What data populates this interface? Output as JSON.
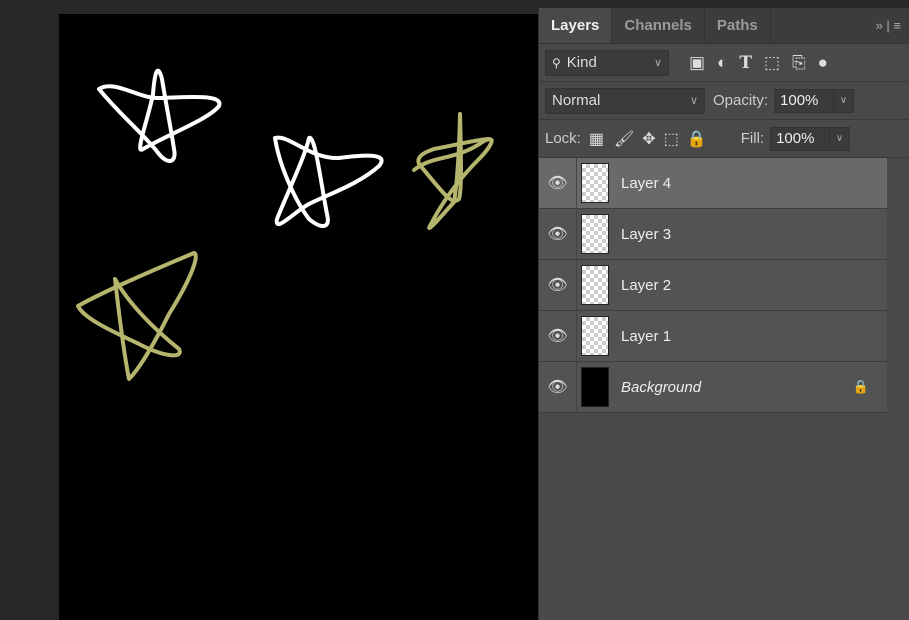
{
  "panel": {
    "tabs": [
      {
        "label": "Layers",
        "active": true
      },
      {
        "label": "Channels"
      },
      {
        "label": "Paths"
      }
    ],
    "menu_icons": "»  |  ≡",
    "filter": {
      "label": "Kind",
      "icon": "search-icon"
    },
    "filter_icons": [
      "image-filter-icon",
      "adjustment-filter-icon",
      "type-filter-icon",
      "shape-filter-icon",
      "smart-object-filter-icon",
      "filter-toggle-icon"
    ],
    "blend_mode": "Normal",
    "opacity_label": "Opacity:",
    "opacity": "100%",
    "lock_label": "Lock:",
    "fill_label": "Fill:",
    "fill": "100%",
    "layers": [
      {
        "name": "Layer 4",
        "selected": true,
        "visible": true
      },
      {
        "name": "Layer 3",
        "visible": true
      },
      {
        "name": "Layer 2",
        "visible": true
      },
      {
        "name": "Layer 1",
        "visible": true
      },
      {
        "name": "Background",
        "visible": true,
        "locked": true,
        "italic": true
      }
    ]
  },
  "canvas": {
    "background": "#000000",
    "stroke_colors": [
      "#ffffff",
      "#b5b56e"
    ]
  }
}
